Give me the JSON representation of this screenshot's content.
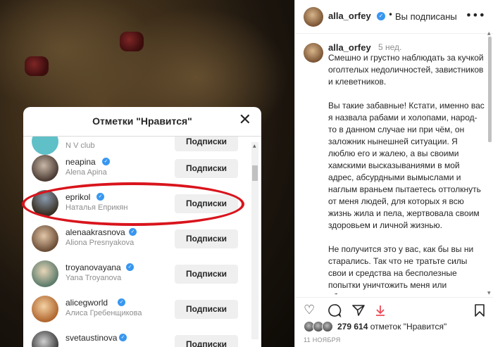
{
  "header": {
    "username": "alla_orfey",
    "separator": "•",
    "follow_status": "Вы подписаны",
    "more_icon": "more-horizontal-icon"
  },
  "caption": {
    "username": "alla_orfey",
    "time": "5 нед.",
    "text": "Смешно и грустно наблюдать за кучкой оголтелых недоличностей, завистников и клеветников.\n\nВы такие забавные! Кстати, именно вас я назвала рабами и холопами, народ-то в данном случае ни при чём, он заложник нынешней ситуации. Я люблю его и жалею, а вы своими хамскими высказываниями в мой адрес, абсурдными вымыслами и наглым враньем пытаетесь оттолкнуть от меня людей, для которых я всю жизнь жила и пела, жертвовала своим здоровьем и личной жизнью.\n\nНе получится это у вас, как бы вы ни старались. Так что не тратьте силы свои и средства на бесполезные попытки уничтожить меня или обесценить мою жизнь и творчество. Мое многомиллионное"
  },
  "likes": {
    "count": "279 614",
    "label": "отметок \"Нравится\""
  },
  "date": "11 НОЯБРЯ",
  "modal": {
    "title": "Отметки \"Нравится\"",
    "close_icon": "close-icon",
    "rows": [
      {
        "username": "",
        "fullname": "N V club",
        "verified": false,
        "button": "Подписки"
      },
      {
        "username": "neapina",
        "fullname": "Alena Apina",
        "verified": true,
        "button": "Подписки"
      },
      {
        "username": "eprikol",
        "fullname": "Наталья Еприкян",
        "verified": true,
        "button": "Подписки"
      },
      {
        "username": "alenaakrasnova",
        "fullname": "Aliona Presnyakova",
        "verified": true,
        "button": "Подписки"
      },
      {
        "username": "troyanovayana",
        "fullname": "Yana Troyanova",
        "verified": true,
        "button": "Подписки"
      },
      {
        "username": "alicegworld",
        "fullname": "Алиса Гребенщикова",
        "verified": true,
        "button": "Подписки"
      },
      {
        "username": "svetaustinova",
        "fullname": "",
        "verified": true,
        "button": "Подписки"
      }
    ]
  },
  "colors": {
    "verified": "#3897f0",
    "highlight": "#d9141c",
    "button_bg": "#efefef"
  }
}
